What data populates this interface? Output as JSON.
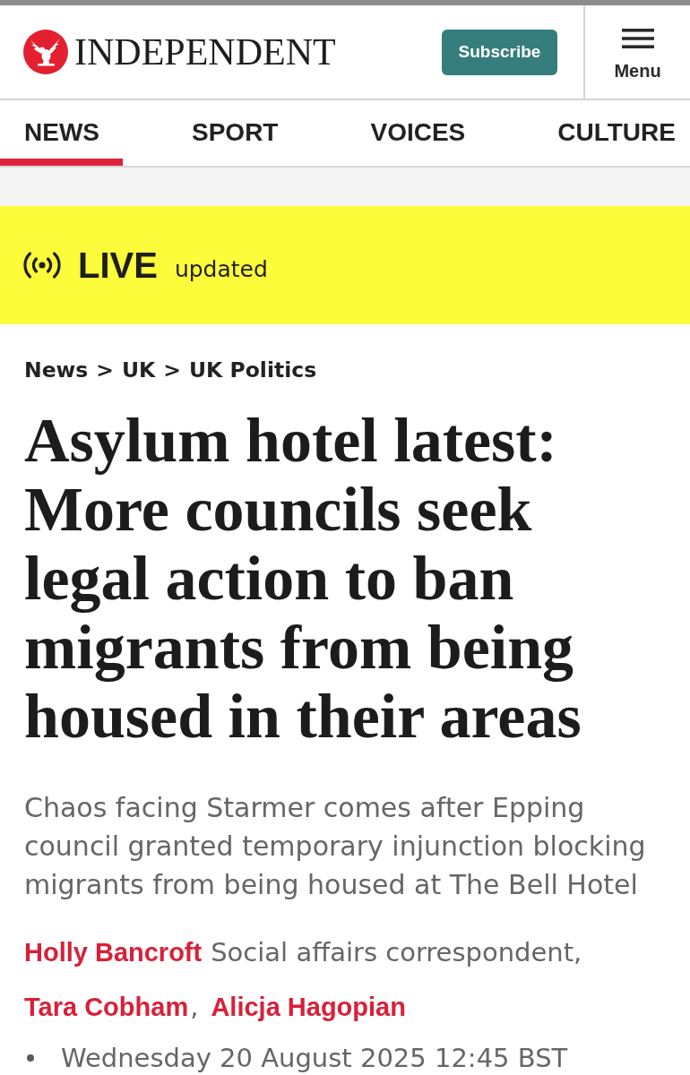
{
  "header": {
    "logo_text": "INDEPENDENT",
    "subscribe_label": "Subscribe",
    "menu_label": "Menu"
  },
  "nav": {
    "tabs": [
      {
        "label": "NEWS",
        "selected": true
      },
      {
        "label": "SPORT",
        "selected": false
      },
      {
        "label": "VOICES",
        "selected": false
      },
      {
        "label": "CULTURE",
        "selected": false
      }
    ]
  },
  "live_banner": {
    "label": "LIVE",
    "status": "updated"
  },
  "breadcrumb": [
    {
      "label": "News",
      "separator": ">"
    },
    {
      "label": "UK",
      "separator": ">"
    },
    {
      "label": "UK Politics"
    }
  ],
  "article": {
    "headline": "Asylum hotel latest: More councils seek legal action to ban migrants from being housed in their areas",
    "standfirst": "Chaos facing Starmer comes after Epping council granted temporary injunction blocking migrants from being housed at The Bell Hotel",
    "byline": [
      {
        "name": "Holly Bancroft",
        "role": "Social affairs correspondent,"
      },
      {
        "name": "Tara Cobham",
        "separator": ","
      },
      {
        "name": "Alicja Hagopian"
      }
    ],
    "date": "Wednesday 20 August 2025 12:45 BST"
  }
}
